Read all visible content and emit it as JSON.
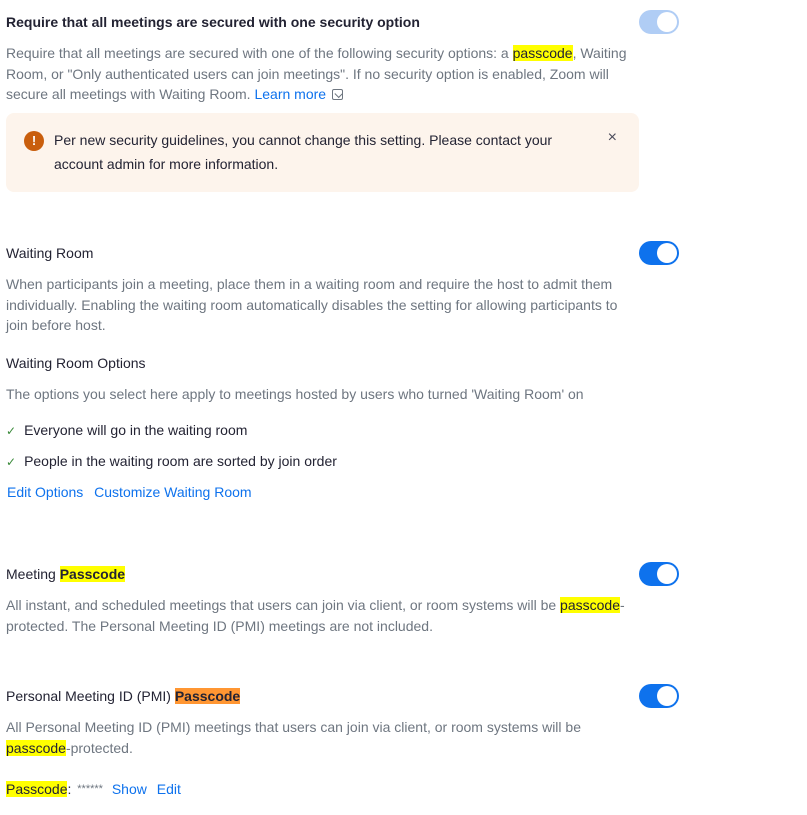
{
  "sections": {
    "secured": {
      "title": "Require that all meetings are secured with one security option",
      "desc_part1": "Require that all meetings are secured with one of the following security options: a ",
      "desc_highlight": "passcode",
      "desc_part2": ", Waiting Room, or \"Only authenticated users can join meetings\". If no security option is enabled, Zoom will secure all meetings with Waiting Room. ",
      "learn_more": "Learn more",
      "toggle_on": true,
      "toggle_disabled": true
    },
    "notice": {
      "icon": "!",
      "text": "Per new security guidelines, you cannot change this setting. Please contact your account admin for more information.",
      "close": "×"
    },
    "waiting_room": {
      "title": "Waiting Room",
      "desc": "When participants join a meeting, place them in a waiting room and require the host to admit them individually. Enabling the waiting room automatically disables the setting for allowing participants to join before host.",
      "toggle_on": true,
      "options_title": "Waiting Room Options",
      "options_desc": "The options you select here apply to meetings hosted by users who turned 'Waiting Room' on",
      "options": [
        {
          "check": "✓",
          "label": "Everyone will go in the waiting room"
        },
        {
          "check": "✓",
          "label": "People in the waiting room are sorted by join order"
        }
      ],
      "edit_options": "Edit Options",
      "customize": "Customize Waiting Room"
    },
    "meeting_passcode": {
      "title_prefix": "Meeting ",
      "title_highlight": "Passcode",
      "desc_part1": "All instant, and scheduled meetings that users can join via client, or room systems will be ",
      "desc_highlight": "passcode",
      "desc_part2": "-protected. The Personal Meeting ID (PMI) meetings are not included.",
      "toggle_on": true
    },
    "pmi_passcode": {
      "title_prefix": "Personal Meeting ID (PMI) ",
      "title_highlight": "Passcode",
      "desc_part1": "All Personal Meeting ID (PMI) meetings that users can join via client, or room systems will be ",
      "desc_highlight": "passcode",
      "desc_part2": "-protected.",
      "toggle_on": true,
      "passcode_label": "Passcode",
      "passcode_colon": ":",
      "passcode_mask": "******",
      "show": "Show",
      "edit": "Edit"
    }
  },
  "colors": {
    "accent": "#0e72ed",
    "highlight": "#ffff00",
    "highlight_current": "#ff9632",
    "notice_bg": "#fdf4ec",
    "warning": "#c95e0d"
  }
}
